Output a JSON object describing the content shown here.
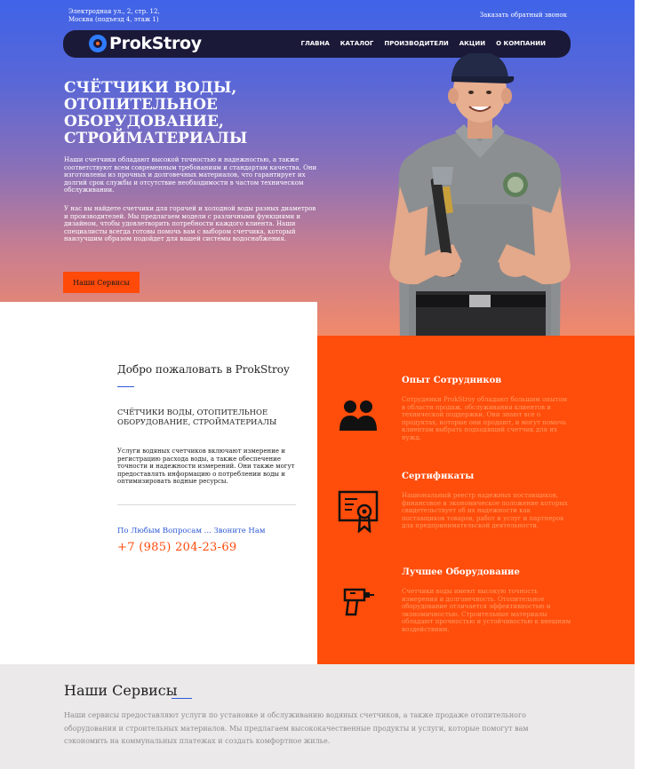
{
  "topbar": {
    "address_line1": "Электродная ул., 2, стр. 12,",
    "address_line2": "Москва (подъезд 4, этаж 1)",
    "callback": "Заказать обратный звонок"
  },
  "logo": {
    "text": "ProkStroy"
  },
  "nav": {
    "items": [
      "ГЛАВНА",
      "КАТАЛОГ",
      "ПРОИЗВОДИТЕЛИ",
      "АКЦИИ",
      "О КОМПАНИИ"
    ]
  },
  "hero": {
    "title": "СЧЁТЧИКИ ВОДЫ, ОТОПИТЕЛЬНОЕ ОБОРУДОВАНИЕ, СТРОЙМАТЕРИАЛЫ",
    "paragraph1": "Наши счетчики обладают высокой точностью и надежностью, а также соответствуют всем современным требованиям и стандартам качества. Они изготовлены из прочных и долговечных материалов, что гарантирует их долгий срок службы и отсутствие необходимости в частом техническом обслуживании.",
    "paragraph2": "У нас вы найдете счетчики для горячей и холодной воды разных диаметров и производителей. Мы предлагаем модели с различными функциями и дизайном, чтобы удовлетворить потребности каждого клиента. Наши специалисты всегда готовы помочь вам с выбором счетчика, который наилучшим образом подойдет для вашей системы водоснабжения.",
    "button": "Наши Сервисы"
  },
  "welcome": {
    "title": "Добро пожаловать в ProkStroy",
    "subtitle": "СЧЁТЧИКИ ВОДЫ, ОТОПИТЕЛЬНОЕ ОБОРУДОВАНИЕ, СТРОЙМАТЕРИАЛЫ",
    "text": "Услуги водяных счетчиков включают измерение и регистрацию расхода воды, а также обеспечение точности и надежности измерений. Они также могут предоставлять информацию о потреблении воды и оптимизировать водные ресурсы.",
    "question": "По Любым Вопросам ... Звоните Нам",
    "phone": "+7 (985) 204-23-69"
  },
  "features": [
    {
      "title": "Опыт Сотрудников",
      "text": "Сотрудники ProkStroy обладают большим опытом в области продаж, обслуживания клиентов и технической поддержки. Они знают все о продуктах, которые они продают, и могут помочь клиентам выбрать подходящий счетчик для их нужд.",
      "icon": "team-icon"
    },
    {
      "title": "Сертификаты",
      "text": "Национальный реестр надежных поставщиков, финансовое и экономическое положение которых свидетельствует об их надежности как поставщиков товаров, работ и услуг и партнеров для предпринимательской деятельности.",
      "icon": "certificate-icon"
    },
    {
      "title": "Лучшее Оборудование",
      "text": "Счетчики воды имеют высокую точность измерения и долговечность. Отопительное оборудование отличается эффективностью и экономичностью. Строительные материалы обладают прочностью и устойчивостью к внешним воздействиям.",
      "icon": "drill-icon"
    }
  ],
  "services": {
    "title": "Наши Сервисы",
    "text": "Наши сервисы предоставляют услуги по установке и обслуживанию водяных счетчиков, а также продаже отопительного оборудования и строительных материалов. Мы предлагаем высококачественные продукты и услуги, которые помогут вам сэкономить на коммунальных платежах и создать комфортное жилье."
  },
  "colors": {
    "accent": "#ff4d0b",
    "nav_bg": "#1b1938",
    "link_blue": "#2f5bd6"
  }
}
